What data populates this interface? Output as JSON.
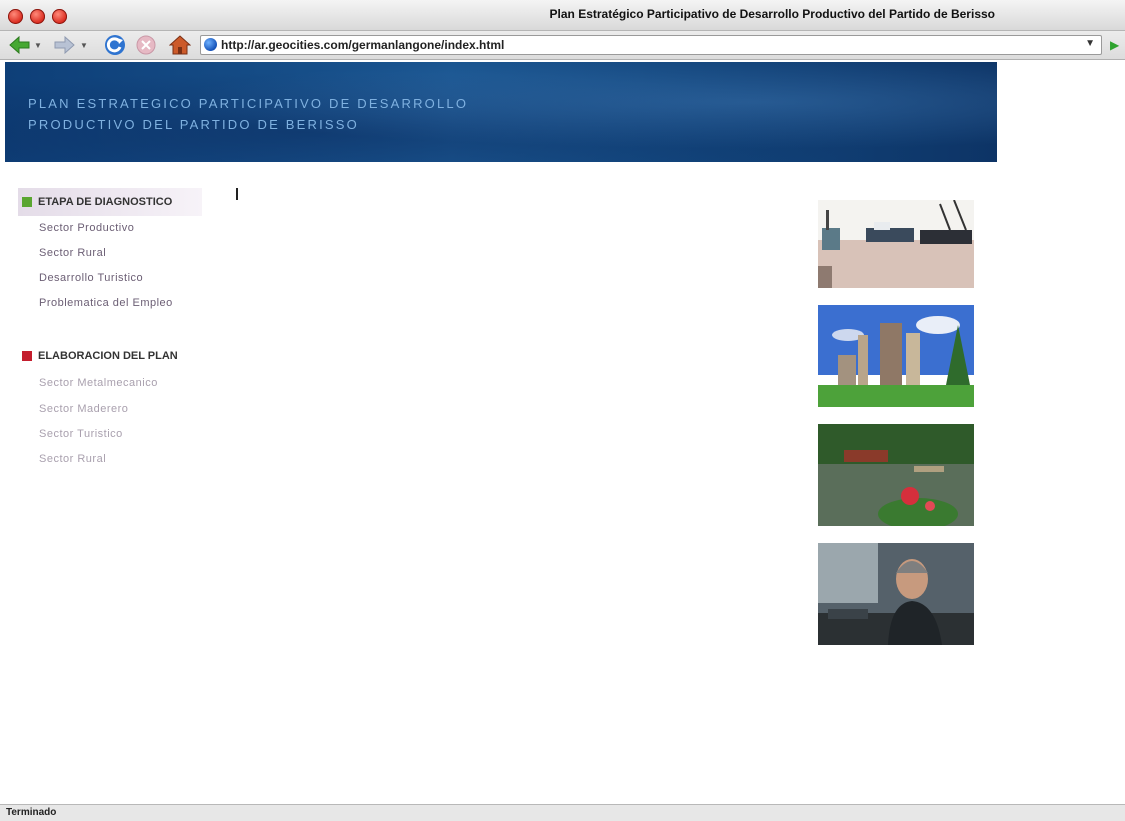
{
  "window": {
    "title": "Plan Estratégico Participativo de Desarrollo Productivo del Partido de Berisso"
  },
  "toolbar": {
    "url": "http://ar.geocities.com/germanlangone/index.html"
  },
  "banner": {
    "line1": "PLAN ESTRATEGICO PARTICIPATIVO DE DESARROLLO",
    "line2": "PRODUCTIVO DEL PARTIDO DE BERISSO"
  },
  "nav": {
    "section1": {
      "title": "ETAPA DE DIAGNOSTICO",
      "color": "#5aa631",
      "items": [
        "Sector Productivo",
        "Sector Rural",
        "Desarrollo Turistico",
        "Problematica del Empleo"
      ]
    },
    "section2": {
      "title": "ELABORACION DEL PLAN",
      "color": "#c41e2e",
      "items": [
        "Sector Metalmecanico",
        "Sector Maderero",
        "Sector Turistico",
        "Sector Rural"
      ]
    }
  },
  "photos": [
    "port-ships-photo",
    "refinery-photo",
    "river-boats-photo",
    "worker-portrait-photo"
  ],
  "status": {
    "text": "Terminado"
  }
}
